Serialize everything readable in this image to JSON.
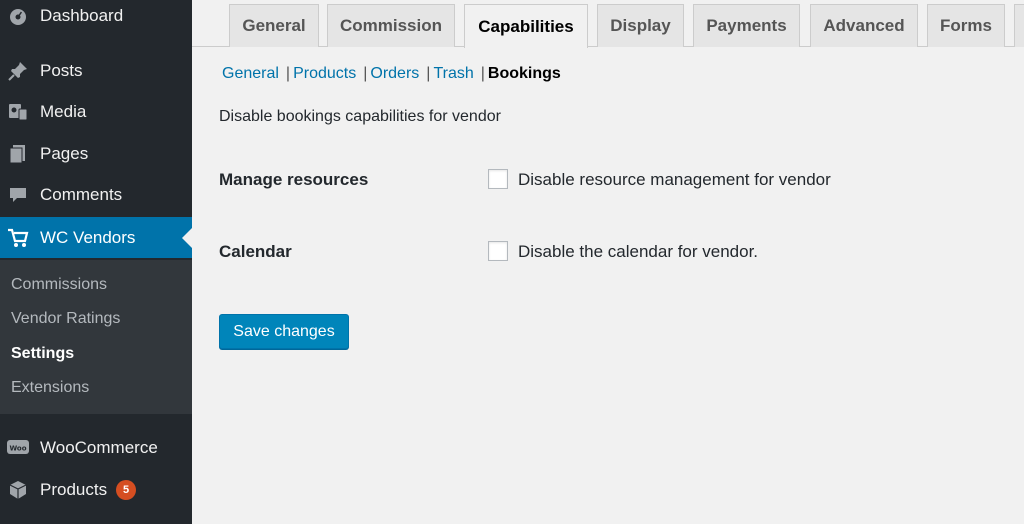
{
  "sidebar": {
    "items": [
      {
        "label": "Dashboard",
        "icon": "dashboard-icon"
      },
      {
        "label": "Posts",
        "icon": "pin-icon"
      },
      {
        "label": "Media",
        "icon": "media-icon"
      },
      {
        "label": "Pages",
        "icon": "pages-icon"
      },
      {
        "label": "Comments",
        "icon": "comment-icon"
      },
      {
        "label": "WC Vendors",
        "icon": "cart-icon"
      },
      {
        "label": "WooCommerce",
        "icon": "woo-icon"
      },
      {
        "label": "Products",
        "icon": "box-icon",
        "badge": "5"
      }
    ],
    "submenu": [
      "Commissions",
      "Vendor Ratings",
      "Settings",
      "Extensions"
    ],
    "active_color": "#0073aa"
  },
  "tabs": [
    "General",
    "Commission",
    "Capabilities",
    "Display",
    "Payments",
    "Advanced",
    "Forms"
  ],
  "subnav": {
    "links": [
      "General",
      "Products",
      "Orders",
      "Trash"
    ],
    "current": "Bookings"
  },
  "section_description": "Disable bookings capabilities for vendor",
  "settings": [
    {
      "label": "Manage resources",
      "checkbox_label": "Disable resource management for vendor",
      "checked": false
    },
    {
      "label": "Calendar",
      "checkbox_label": "Disable the calendar for vendor.",
      "checked": false
    }
  ],
  "save_label": "Save changes"
}
